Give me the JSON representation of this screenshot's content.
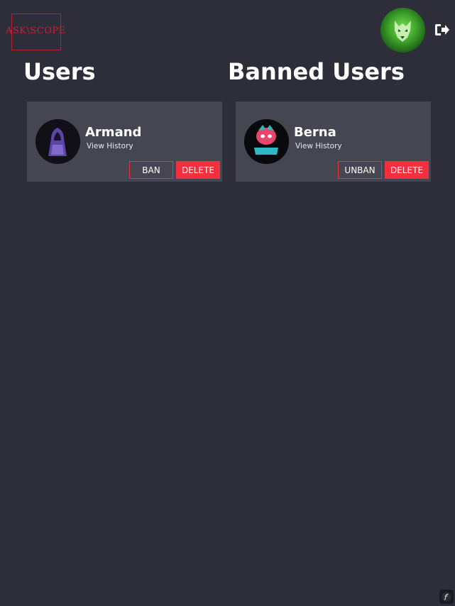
{
  "brand": {
    "logo_text_left": "ASK",
    "logo_text_mid": "\\",
    "logo_text_right": "SCOPE"
  },
  "header": {
    "avatar_icon": "wolf-avatar-icon",
    "logout_icon": "sign-out-icon"
  },
  "sections": {
    "users_title": "Users",
    "banned_title": "Banned Users"
  },
  "users": [
    {
      "name": "Armand",
      "history_label": "View History",
      "primary_action": "BAN",
      "secondary_action": "DELETE"
    }
  ],
  "banned_users": [
    {
      "name": "Berna",
      "history_label": "View History",
      "primary_action": "UNBAN",
      "secondary_action": "DELETE"
    }
  ],
  "colors": {
    "background": "#2e2e3a",
    "card": "#464653",
    "accent": "#f52f3e"
  }
}
